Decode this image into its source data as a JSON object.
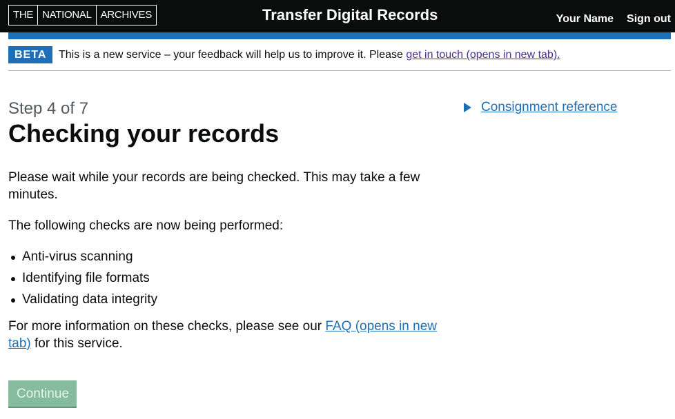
{
  "header": {
    "logo_parts": [
      "THE",
      "NATIONAL",
      "ARCHIVES"
    ],
    "service_name": "Transfer Digital Records",
    "nav": {
      "user_name": "Your Name",
      "sign_out": "Sign out"
    }
  },
  "beta_banner": {
    "tag": "BETA",
    "text": "This is a new service – your feedback will help us to improve it. Please ",
    "link": "get in touch (opens in new tab)."
  },
  "main": {
    "caption": "Step 4 of 7",
    "title": "Checking your records",
    "paragraph1": "Please wait while your records are being checked. This may take a few minutes.",
    "paragraph2": "The following checks are now being performed:",
    "checks": [
      "Anti-virus scanning",
      "Identifying file formats",
      "Validating data integrity"
    ],
    "paragraph3_before": "For more information on these checks, please see our ",
    "faq_link": "FAQ (opens in new tab)",
    "paragraph3_after": " for this service.",
    "continue_label": "Continue"
  },
  "aside": {
    "details_summary": "Consignment reference"
  },
  "colors": {
    "header_bg": "#0b0c0c",
    "brand_blue": "#1d70b8",
    "visited_link": "#4c2c92",
    "disabled_button": "#85bc9d"
  }
}
